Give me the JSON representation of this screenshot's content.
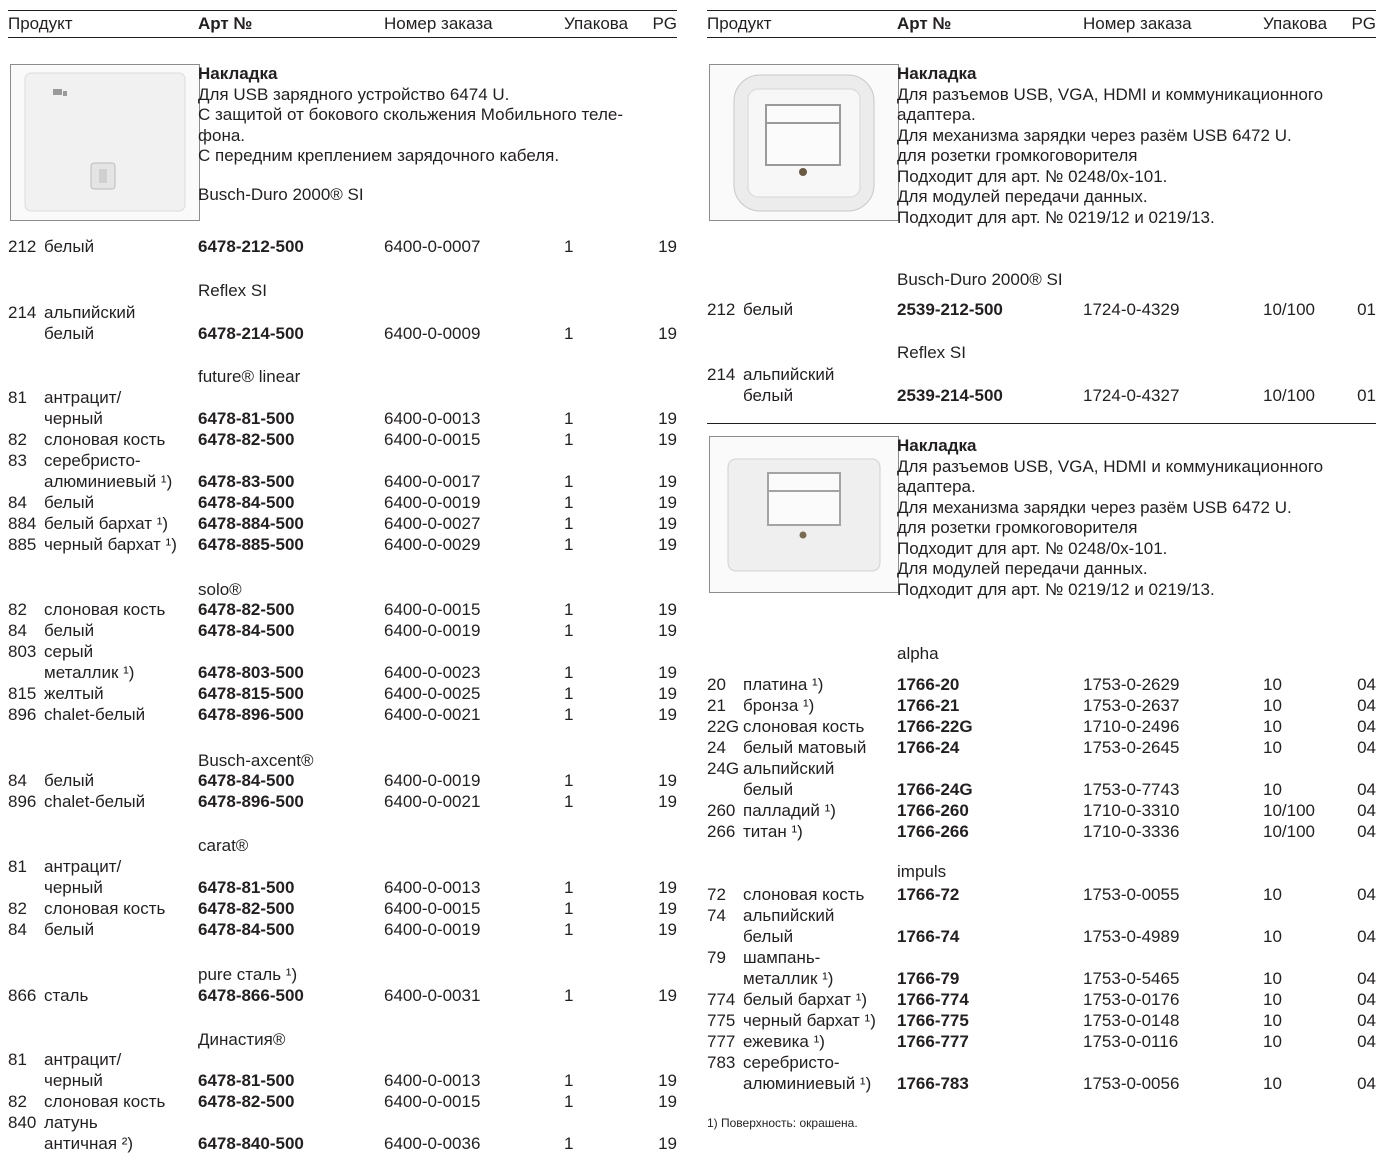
{
  "columns": {
    "product": "Продукт",
    "art": "Арт №",
    "order": "Номер заказа",
    "pack": "Упакова",
    "pg": "PG"
  },
  "left": {
    "title": "Накладка",
    "desc": [
      "Для USB зарядного устройство 6474 U.",
      "С защитой от бокового скольжения Мобильного теле-",
      "фона.",
      "С передним креплением зарядочного кабеля."
    ],
    "s0": "Busch-Duro 2000® SI",
    "s1": "Reflex SI",
    "s2": "future® linear",
    "s3": "solo®",
    "s4": "Busch-axcent®",
    "s5": "carat®",
    "s6": "pure сталь ¹)",
    "s7": "Династия®",
    "rows": [
      {
        "n": "212",
        "m": "белый",
        "a": "6478-212-500",
        "o": "6400-0-0007",
        "p": "1",
        "g": "19"
      },
      {
        "n": "214",
        "m": "альпийский",
        "a": "",
        "o": "",
        "p": "",
        "g": ""
      },
      {
        "n": "",
        "m": "белый",
        "a": "6478-214-500",
        "o": "6400-0-0009",
        "p": "1",
        "g": "19"
      },
      {
        "n": "81",
        "m": "антрацит/",
        "a": "",
        "o": "",
        "p": "",
        "g": ""
      },
      {
        "n": "",
        "m": "черный",
        "a": "6478-81-500",
        "o": "6400-0-0013",
        "p": "1",
        "g": "19"
      },
      {
        "n": "82",
        "m": "слоновая кость",
        "a": "6478-82-500",
        "o": "6400-0-0015",
        "p": "1",
        "g": "19"
      },
      {
        "n": "83",
        "m": "серебристо-",
        "a": "",
        "o": "",
        "p": "",
        "g": ""
      },
      {
        "n": "",
        "m": "алюминиевый ¹)",
        "a": "6478-83-500",
        "o": "6400-0-0017",
        "p": "1",
        "g": "19"
      },
      {
        "n": "84",
        "m": "белый",
        "a": "6478-84-500",
        "o": "6400-0-0019",
        "p": "1",
        "g": "19"
      },
      {
        "n": "884",
        "m": "белый бархат ¹)",
        "a": "6478-884-500",
        "o": "6400-0-0027",
        "p": "1",
        "g": "19"
      },
      {
        "n": "885",
        "m": "черный бархат ¹)",
        "a": "6478-885-500",
        "o": "6400-0-0029",
        "p": "1",
        "g": "19"
      },
      {
        "n": "82",
        "m": "слоновая кость",
        "a": "6478-82-500",
        "o": "6400-0-0015",
        "p": "1",
        "g": "19"
      },
      {
        "n": "84",
        "m": "белый",
        "a": "6478-84-500",
        "o": "6400-0-0019",
        "p": "1",
        "g": "19"
      },
      {
        "n": "803",
        "m": "серый",
        "a": "",
        "o": "",
        "p": "",
        "g": ""
      },
      {
        "n": "",
        "m": "металлик ¹)",
        "a": "6478-803-500",
        "o": "6400-0-0023",
        "p": "1",
        "g": "19"
      },
      {
        "n": "815",
        "m": "желтый",
        "a": "6478-815-500",
        "o": "6400-0-0025",
        "p": "1",
        "g": "19"
      },
      {
        "n": "896",
        "m": "chalet-белый",
        "a": "6478-896-500",
        "o": "6400-0-0021",
        "p": "1",
        "g": "19"
      },
      {
        "n": "84",
        "m": "белый",
        "a": "6478-84-500",
        "o": "6400-0-0019",
        "p": "1",
        "g": "19"
      },
      {
        "n": "896",
        "m": "chalet-белый",
        "a": "6478-896-500",
        "o": "6400-0-0021",
        "p": "1",
        "g": "19"
      },
      {
        "n": "81",
        "m": "антрацит/",
        "a": "",
        "o": "",
        "p": "",
        "g": ""
      },
      {
        "n": "",
        "m": "черный",
        "a": "6478-81-500",
        "o": "6400-0-0013",
        "p": "1",
        "g": "19"
      },
      {
        "n": "82",
        "m": "слоновая кость",
        "a": "6478-82-500",
        "o": "6400-0-0015",
        "p": "1",
        "g": "19"
      },
      {
        "n": "84",
        "m": "белый",
        "a": "6478-84-500",
        "o": "6400-0-0019",
        "p": "1",
        "g": "19"
      },
      {
        "n": "866",
        "m": "сталь",
        "a": "6478-866-500",
        "o": "6400-0-0031",
        "p": "1",
        "g": "19"
      },
      {
        "n": "81",
        "m": "антрацит/",
        "a": "",
        "o": "",
        "p": "",
        "g": ""
      },
      {
        "n": "",
        "m": "черный",
        "a": "6478-81-500",
        "o": "6400-0-0013",
        "p": "1",
        "g": "19"
      },
      {
        "n": "82",
        "m": "слоновая кость",
        "a": "6478-82-500",
        "o": "6400-0-0015",
        "p": "1",
        "g": "19"
      },
      {
        "n": "840",
        "m": "латунь",
        "a": "",
        "o": "",
        "p": "",
        "g": ""
      },
      {
        "n": "",
        "m": "античная ²)",
        "a": "6478-840-500",
        "o": "6400-0-0036",
        "p": "1",
        "g": "19"
      }
    ]
  },
  "right": {
    "title1": "Накладка",
    "desc1": [
      "Для разъемов USB, VGA, HDMI и коммуникационного",
      "адаптера.",
      "Для механизма зарядки через разём USB 6472 U.",
      "для розетки громкоговорителя",
      "Подходит для арт. № 0248/0x-101.",
      "Для модулей передачи данных.",
      "Подходит для арт. № 0219/12 и 0219/13."
    ],
    "title2": "Накладка",
    "desc2": [
      "Для разъемов USB, VGA, HDMI и коммуникационного",
      "адаптера.",
      "Для механизма зарядки через разём USB 6472 U.",
      "для розетки громкоговорителя",
      "Подходит для арт. № 0248/0x-101.",
      "Для модулей передачи данных.",
      "Подходит для арт. № 0219/12 и 0219/13."
    ],
    "s0": "Busch-Duro 2000® SI",
    "s1": "Reflex SI",
    "s2": "alpha",
    "s3": "impuls",
    "footnote": "1)  Поверхность: окрашена.",
    "rows": [
      {
        "n": "212",
        "m": "белый",
        "a": "2539-212-500",
        "o": "1724-0-4329",
        "p": "10/100",
        "g": "01"
      },
      {
        "n": "214",
        "m": "альпийский",
        "a": "",
        "o": "",
        "p": "",
        "g": ""
      },
      {
        "n": "",
        "m": "белый",
        "a": "2539-214-500",
        "o": "1724-0-4327",
        "p": "10/100",
        "g": "01"
      },
      {
        "n": "20",
        "m": "платина ¹)",
        "a": "1766-20",
        "o": "1753-0-2629",
        "p": "10",
        "g": "04"
      },
      {
        "n": "21",
        "m": "бронза ¹)",
        "a": "1766-21",
        "o": "1753-0-2637",
        "p": "10",
        "g": "04"
      },
      {
        "n": "22G",
        "m": "слоновая кость",
        "a": "1766-22G",
        "o": "1710-0-2496",
        "p": "10",
        "g": "04"
      },
      {
        "n": "24",
        "m": "белый матовый",
        "a": "1766-24",
        "o": "1753-0-2645",
        "p": "10",
        "g": "04"
      },
      {
        "n": "24G",
        "m": "альпийский",
        "a": "",
        "o": "",
        "p": "",
        "g": ""
      },
      {
        "n": "",
        "m": "белый",
        "a": "1766-24G",
        "o": "1753-0-7743",
        "p": "10",
        "g": "04"
      },
      {
        "n": "260",
        "m": "палладий ¹)",
        "a": "1766-260",
        "o": "1710-0-3310",
        "p": "10/100",
        "g": "04"
      },
      {
        "n": "266",
        "m": "титан ¹)",
        "a": "1766-266",
        "o": "1710-0-3336",
        "p": "10/100",
        "g": "04"
      },
      {
        "n": "72",
        "m": "слоновая кость",
        "a": "1766-72",
        "o": "1753-0-0055",
        "p": "10",
        "g": "04"
      },
      {
        "n": "74",
        "m": "альпийский",
        "a": "",
        "o": "",
        "p": "",
        "g": ""
      },
      {
        "n": "",
        "m": "белый",
        "a": "1766-74",
        "o": "1753-0-4989",
        "p": "10",
        "g": "04"
      },
      {
        "n": "79",
        "m": "шампань-",
        "a": "",
        "o": "",
        "p": "",
        "g": ""
      },
      {
        "n": "",
        "m": "металлик ¹)",
        "a": "1766-79",
        "o": "1753-0-5465",
        "p": "10",
        "g": "04"
      },
      {
        "n": "774",
        "m": "белый бархат ¹)",
        "a": "1766-774",
        "o": "1753-0-0176",
        "p": "10",
        "g": "04"
      },
      {
        "n": "775",
        "m": "черный бархат ¹)",
        "a": "1766-775",
        "o": "1753-0-0148",
        "p": "10",
        "g": "04"
      },
      {
        "n": "777",
        "m": "ежевика ¹)",
        "a": "1766-777",
        "o": "1753-0-0116",
        "p": "10",
        "g": "04"
      },
      {
        "n": "783",
        "m": "серебристо-",
        "a": "",
        "o": "",
        "p": "",
        "g": ""
      },
      {
        "n": "",
        "m": "алюминиевый ¹)",
        "a": "1766-783",
        "o": "1753-0-0056",
        "p": "10",
        "g": "04"
      }
    ]
  }
}
